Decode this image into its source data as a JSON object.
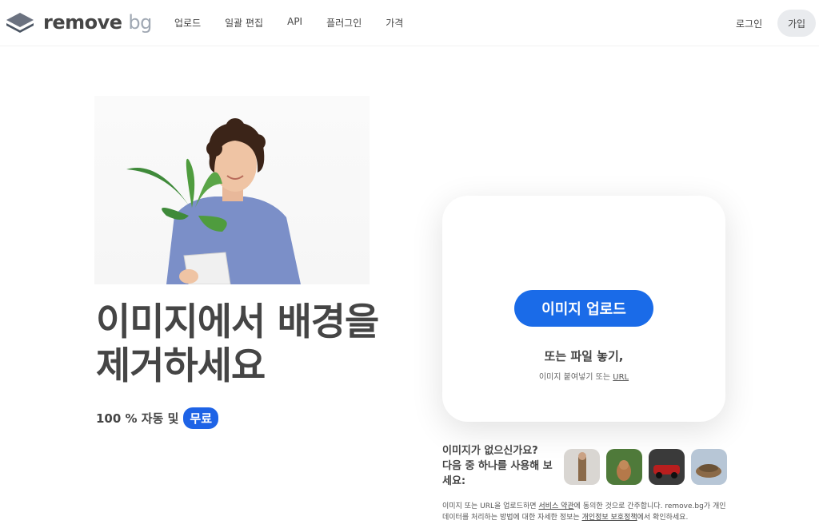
{
  "header": {
    "logo_word": "remove",
    "logo_suffix": "bg",
    "nav": [
      "업로드",
      "일괄 편집",
      "API",
      "플러그인",
      "가격"
    ],
    "login": "로그인",
    "signup": "가입"
  },
  "hero": {
    "headline_line1": "이미지에서 배경을",
    "headline_line2": "제거하세요",
    "subline": "100 % 자동 및",
    "free_badge": "무료"
  },
  "upload": {
    "button": "이미지 업로드",
    "drop_title": "또는 파일 놓기,",
    "drop_sub_prefix": "이미지 붙여넣기 또는",
    "drop_sub_link": "URL"
  },
  "samples": {
    "prompt_line1": "이미지가 없으신가요?",
    "prompt_line2": "다음 중 하나를 사용해 보",
    "prompt_line3": "세요:"
  },
  "terms": {
    "part1": "이미지 또는 URL을 업로드하면",
    "link1": "서비스 약관",
    "part2": "에 동의한 것으로 간주합니다. remove.bg가 개인 데이터를 처리하는 방법에 대한 자세한 정보는",
    "link2": "개인정보 보호정책",
    "part3": "에서 확인하세요."
  },
  "colors": {
    "primary": "#1a6be8",
    "text": "#454545"
  }
}
